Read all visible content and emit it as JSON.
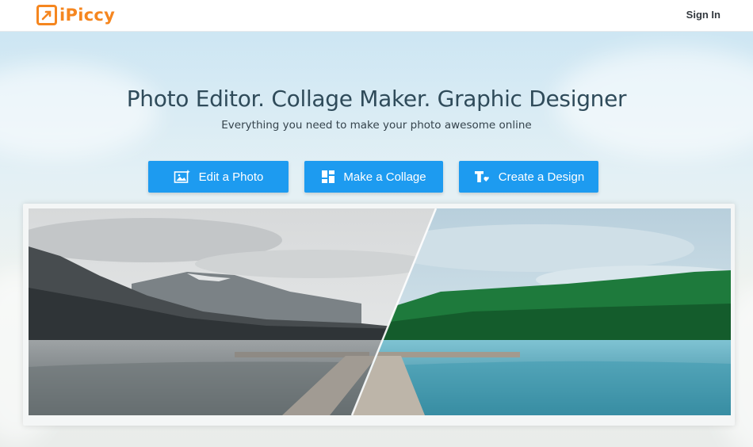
{
  "header": {
    "brand": "iPiccy",
    "sign_in_label": "Sign In"
  },
  "hero": {
    "title": "Photo Editor. Collage Maker. Graphic Designer",
    "subtitle": "Everything you need to make your photo awesome online",
    "buttons": [
      {
        "label": "Edit a Photo",
        "icon": "photo-edit-icon"
      },
      {
        "label": "Make a Collage",
        "icon": "collage-grid-icon"
      },
      {
        "label": "Create a Design",
        "icon": "text-design-icon"
      }
    ]
  },
  "colors": {
    "brand_orange": "#f5861f",
    "button_blue": "#1d9bf0",
    "title_color": "#2f4b5a"
  }
}
